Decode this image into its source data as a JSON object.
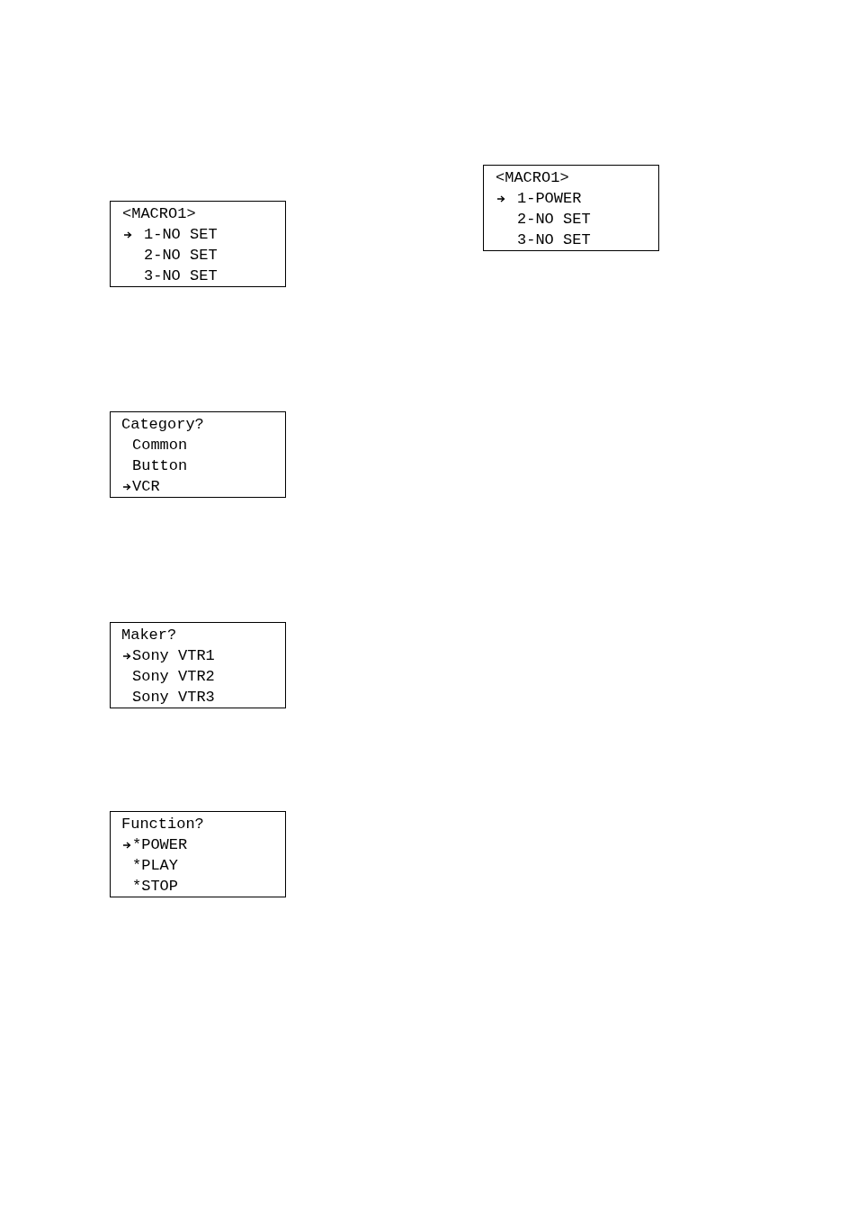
{
  "left_screens": [
    {
      "kind": "macro",
      "title": "<MACRO1>",
      "items": [
        {
          "label": "1-NO SET",
          "selected": true
        },
        {
          "label": "2-NO SET",
          "selected": false
        },
        {
          "label": "3-NO SET",
          "selected": false
        }
      ]
    },
    {
      "kind": "select",
      "title": "Category?",
      "items": [
        {
          "label": "Common",
          "selected": false
        },
        {
          "label": "Button",
          "selected": false
        },
        {
          "label": "VCR",
          "selected": true
        }
      ]
    },
    {
      "kind": "select",
      "title": "Maker?",
      "items": [
        {
          "label": "Sony VTR1",
          "selected": true
        },
        {
          "label": "Sony VTR2",
          "selected": false
        },
        {
          "label": "Sony VTR3",
          "selected": false
        }
      ]
    },
    {
      "kind": "select",
      "title": "Function?",
      "items": [
        {
          "label": "*POWER",
          "selected": true
        },
        {
          "label": "*PLAY",
          "selected": false
        },
        {
          "label": "*STOP",
          "selected": false
        }
      ]
    }
  ],
  "right_screens": [
    {
      "kind": "macro",
      "title": "<MACRO1>",
      "items": [
        {
          "label": "1-POWER",
          "selected": true
        },
        {
          "label": "2-NO SET",
          "selected": false
        },
        {
          "label": "3-NO SET",
          "selected": false
        }
      ]
    }
  ]
}
